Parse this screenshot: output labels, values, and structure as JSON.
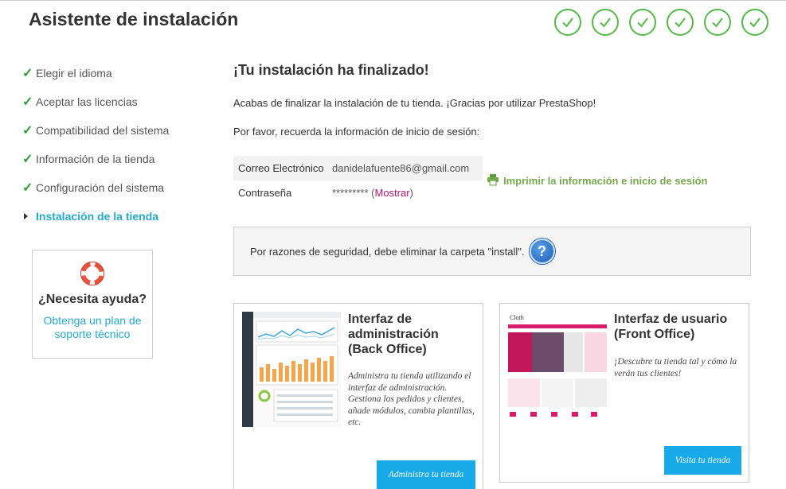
{
  "header": {
    "title": "Asistente de instalación"
  },
  "progress": {
    "completed_steps": 6,
    "total_steps": 6,
    "check_color": "#55b84a"
  },
  "sidebar": {
    "items": [
      {
        "label": "Elegir el idioma",
        "state": "done"
      },
      {
        "label": "Aceptar las licencias",
        "state": "done"
      },
      {
        "label": "Compatibilidad del sistema",
        "state": "done"
      },
      {
        "label": "Información de la tienda",
        "state": "done"
      },
      {
        "label": "Configuración del sistema",
        "state": "done"
      },
      {
        "label": "Instalación de la tienda",
        "state": "active"
      }
    ],
    "help": {
      "question": "¿Necesita ayuda?",
      "link": "Obtenga un plan de soporte técnico",
      "icon": "lifebuoy-icon"
    }
  },
  "main": {
    "heading": "¡Tu instalación ha finalizado!",
    "intro": "Acabas de finalizar la instalación de tu tienda. ¡Gracias por utilizar PrestaShop!",
    "reminder": "Por favor, recuerda la información de inicio de sesión:",
    "credentials": {
      "email_label": "Correo Electrónico",
      "email_value": "danidelafuente86@gmail.com",
      "password_label": "Contraseña",
      "password_value": "*********",
      "show_label": "Mostrar"
    },
    "print_label": "Imprimir la información e inicio de sesión",
    "warning": "Por razones de seguridad, debe eliminar la carpeta \"install\".",
    "cards": [
      {
        "title": "Interfaz de administración (Back Office)",
        "description": "Administra tu tienda utilizando el interfaz de administración. Gestiona los pedidos y clientes, añade módulos, cambia plantillas, etc.",
        "button": "Administra tu tienda"
      },
      {
        "title": "Interfaz de usuario (Front Office)",
        "description": "¡Descubre tu tienda tal y cómo la verán tus clientes!",
        "button": "Visita tu tienda"
      }
    ]
  },
  "colors": {
    "accent": "#25a9c9",
    "button": "#18a9e8",
    "print": "#76a94e",
    "link": "#b0166f"
  }
}
